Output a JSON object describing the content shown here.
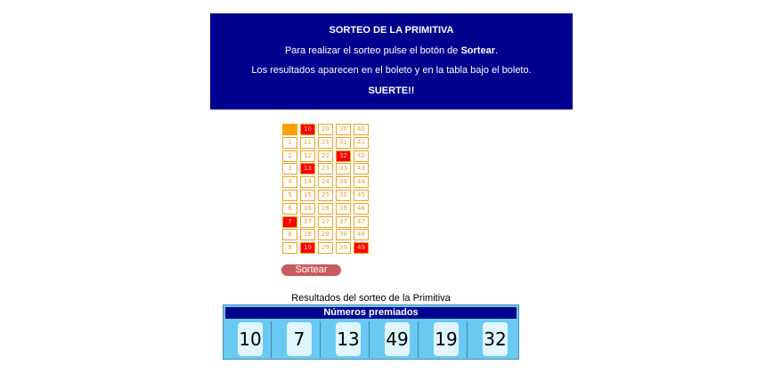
{
  "banner": {
    "title": "SORTEO DE LA PRIMITIVA",
    "instruction_prefix": "Para realizar el sorteo pulse el botón de ",
    "instruction_button": "Sortear",
    "instruction_suffix": ".",
    "results_note": "Los resultados aparecen en el boleto y en la tabla bajo el boleto.",
    "good_luck": "SUERTE!!"
  },
  "ticket": {
    "rows": [
      [
        "",
        "10",
        "20",
        "30",
        "40"
      ],
      [
        "1",
        "11",
        "21",
        "31",
        "41"
      ],
      [
        "2",
        "12",
        "22",
        "32",
        "42"
      ],
      [
        "3",
        "13",
        "23",
        "33",
        "43"
      ],
      [
        "4",
        "14",
        "24",
        "34",
        "44"
      ],
      [
        "5",
        "15",
        "25",
        "35",
        "45"
      ],
      [
        "6",
        "16",
        "26",
        "36",
        "46"
      ],
      [
        "7",
        "17",
        "27",
        "37",
        "47"
      ],
      [
        "8",
        "18",
        "28",
        "38",
        "48"
      ],
      [
        "9",
        "19",
        "29",
        "39",
        "49"
      ]
    ],
    "selected": [
      "10",
      "32",
      "13",
      "7",
      "19",
      "49"
    ]
  },
  "draw_button_label": "Sortear",
  "results": {
    "caption": "Resultados del sorteo de la Primitiva",
    "header": "Números premiados",
    "numbers": [
      "10",
      "7",
      "13",
      "49",
      "19",
      "32"
    ]
  },
  "colors": {
    "banner_bg": "#00008f",
    "ticket_border": "#f0a020",
    "selected_cell": "#ff0000",
    "button": "#c85c5c",
    "results_bg": "#6ac9f2"
  }
}
